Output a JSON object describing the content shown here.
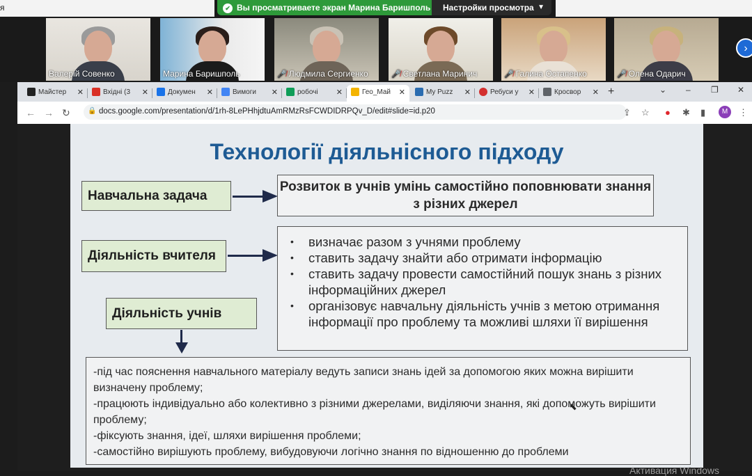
{
  "zoom": {
    "left_label": "я",
    "share_banner": "Вы просматриваете экран Марина Баришполь",
    "view_settings": "Настройки просмотра",
    "participants": [
      {
        "name": "Валерій Совенко",
        "muted": false
      },
      {
        "name": "Марина Баришполь",
        "muted": false,
        "active": true
      },
      {
        "name": "Людмила Сергиенко",
        "muted": true
      },
      {
        "name": "Светлана Маринич",
        "muted": true
      },
      {
        "name": "Галина Остапенко",
        "muted": true
      },
      {
        "name": "Олена Одарич",
        "muted": true
      }
    ]
  },
  "browser": {
    "tabs": [
      {
        "label": "Майстер",
        "color": "#222222"
      },
      {
        "label": "Вхідні (3",
        "color": "#d93025"
      },
      {
        "label": "Докумен",
        "color": "#1a73e8"
      },
      {
        "label": "Вимоги",
        "color": "#4285f4"
      },
      {
        "label": "робочі",
        "color": "#0f9d58"
      },
      {
        "label": "Гео_Май",
        "color": "#f4b400",
        "active": true
      },
      {
        "label": "My Puzz",
        "color": "#2b6cb0"
      },
      {
        "label": "Ребуси у",
        "color": "#d32f2f"
      },
      {
        "label": "Кросвор",
        "color": "#5f6368"
      }
    ],
    "url": "docs.google.com/presentation/d/1rh-8LePHhjdtuAmRMzRsFCWDIDRPQv_D/edit#slide=id.p20",
    "avatar_letter": "M"
  },
  "slide": {
    "title": "Технології діяльнісного підходу",
    "task_label": "Навчальна задача",
    "task_goal": "Розвиток в учнів умінь самостійно поповнювати знання з різних джерел",
    "teacher_label": "Діяльність вчителя",
    "teacher_items": [
      "визначає разом з учнями проблему",
      "ставить задачу знайти або отримати інформацію",
      "ставить задачу  провести самостійний пошук знань з різних інформаційних джерел",
      "організовує навчальну діяльність учнів  з метою отримання інформації про проблему та можливі шляхи її вирішення"
    ],
    "students_label": "Діяльність учнів",
    "students_items": [
      "-під час пояснення  навчального матеріалу ведуть записи знань ідей за допомогою яких можна вирішити визначену проблему;",
      "-працюють індивідуально або колективно з різними джерелами, виділяючи знання, які допоможуть вирішити проблему;",
      "-фіксують знання, ідеї, шляхи вирішення проблеми;",
      "-самостійно вирішують проблему, вибудовуючи логічно знання по відношенню до проблеми"
    ]
  },
  "watermark": "Активация Windows"
}
